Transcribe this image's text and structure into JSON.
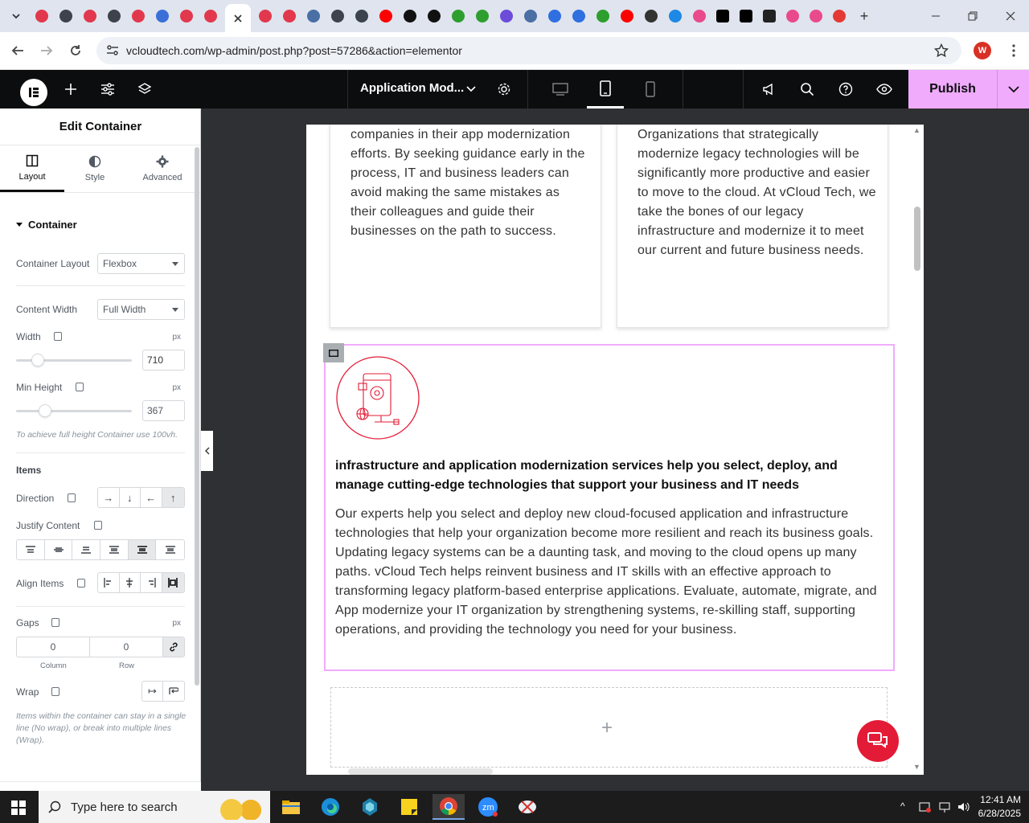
{
  "browser": {
    "url": "vcloudtech.com/wp-admin/post.php?post=57286&action=elementor",
    "profile_initial": "W",
    "tab_icons": [
      "elementor-icon",
      "wp-icon",
      "elementor-icon",
      "wp-icon",
      "elementor-icon",
      "edge-icon",
      "elementor-icon",
      "elementor-icon",
      "close-tab",
      "elementor-icon",
      "elementor-icon",
      "chart-icon",
      "wp-icon",
      "wp-icon",
      "youtube-icon",
      "openai-icon",
      "openai-icon",
      "lightning-icon",
      "lightning-icon",
      "spiral-icon",
      "chart-icon",
      "dots-icon",
      "dots-icon",
      "lightning-icon",
      "youtube-icon",
      "hat-icon",
      "cloud-icon",
      "ring-icon",
      "x-icon",
      "x-icon",
      "n-icon",
      "ring-icon",
      "ring-icon",
      "pen-icon"
    ]
  },
  "editor": {
    "document_title": "Application Mod...",
    "publish_label": "Publish"
  },
  "panel": {
    "title": "Edit Container",
    "tabs": [
      {
        "label": "Layout"
      },
      {
        "label": "Style"
      },
      {
        "label": "Advanced"
      }
    ],
    "section_title": "Container",
    "container_layout": {
      "label": "Container Layout",
      "value": "Flexbox"
    },
    "content_width": {
      "label": "Content Width",
      "value": "Full Width"
    },
    "width": {
      "label": "Width",
      "unit": "px",
      "value": "710",
      "slider_fraction": 0.19
    },
    "min_height": {
      "label": "Min Height",
      "unit": "px",
      "value": "367",
      "slider_fraction": 0.25
    },
    "min_height_note": "To achieve full height Container use 100vh.",
    "items_title": "Items",
    "direction_label": "Direction",
    "justify_label": "Justify Content",
    "align_label": "Align Items",
    "gaps": {
      "label": "Gaps",
      "unit": "px",
      "column": "0",
      "row": "0",
      "column_label": "Column",
      "row_label": "Row"
    },
    "wrap_label": "Wrap",
    "wrap_note": "Items within the container can stay in a single line (No wrap), or break into multiple lines (Wrap)."
  },
  "canvas": {
    "card_left_text": "expertise that has helped countless companies in their app modernization efforts. By seeking guidance early in the process, IT and business leaders can avoid making the same mistakes as their colleagues and guide their businesses on the path to success.",
    "card_right_text": "intelligence and machine learning tools. Organizations that strategically modernize legacy technologies will be significantly more productive and easier to move to the cloud. At vCloud Tech, we take the bones of our legacy infrastructure and modernize it to meet our current and future business needs.",
    "heading": "infrastructure and application modernization services help you select, deploy, and manage cutting-edge technologies that support your business and IT needs",
    "paragraph": "Our experts help you select and deploy new cloud-focused application and infrastructure technologies that help your organization become more resilient and reach its business goals. Updating legacy systems can be a daunting task, and moving to the cloud opens up many paths. vCloud Tech helps reinvent business and IT skills with an effective approach to transforming legacy platform-based enterprise applications. Evaluate, automate, migrate, and App modernize your IT organization by strengthening systems, re-skilling staff, supporting operations, and providing the technology you need for your business.",
    "add_symbol": "+"
  },
  "taskbar": {
    "search_placeholder": "Type here to search",
    "time": "12:41 AM",
    "date": "6/28/2025"
  },
  "colors": {
    "accent": "#f0abfc",
    "editor_bar": "#0c0d0e",
    "brand_red": "#e41b36"
  }
}
